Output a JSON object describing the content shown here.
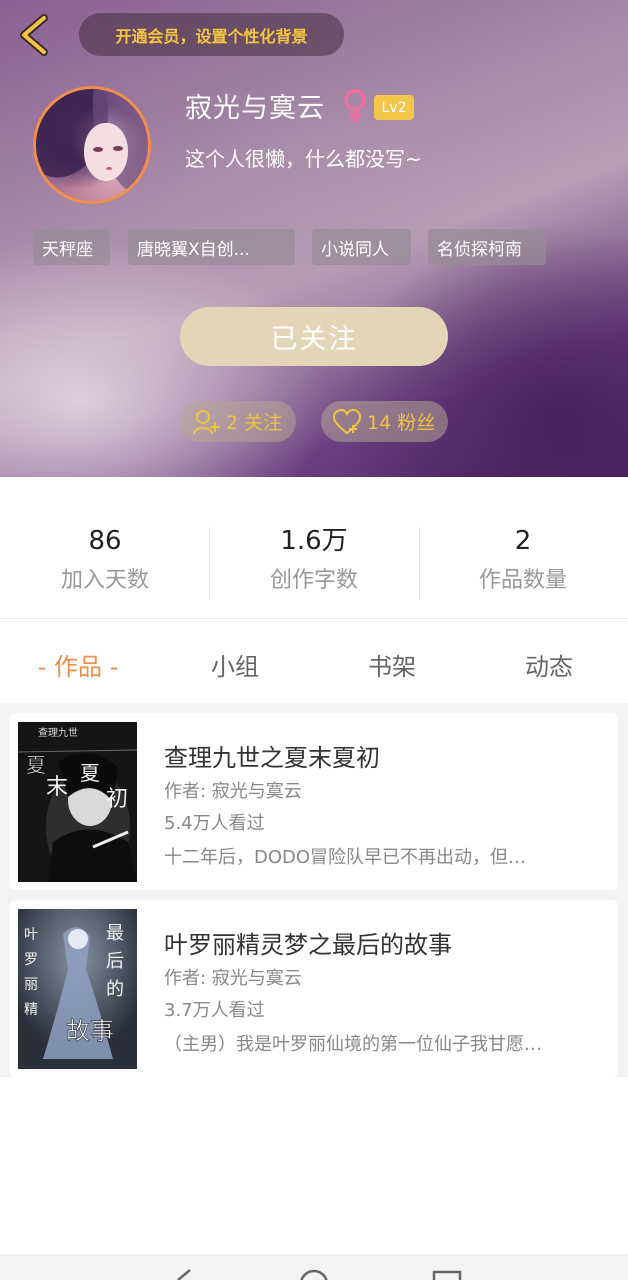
{
  "header": {
    "vip_banner": "开通会员，设置个性化背景",
    "username": "寂光与寞云",
    "level": "Lv2",
    "bio": "这个人很懒，什么都没写~",
    "tags": [
      "天秤座",
      "唐晓翼X自创...",
      "小说同人",
      "名侦探柯南"
    ],
    "follow_button": "已关注",
    "following": "2 关注",
    "fans": "14 粉丝",
    "accent_color": "#f08e4c",
    "badge_color": "#f3c64a"
  },
  "stats": [
    {
      "value": "86",
      "label": "加入天数"
    },
    {
      "value": "1.6万",
      "label": "创作字数"
    },
    {
      "value": "2",
      "label": "作品数量"
    }
  ],
  "tabs": [
    "- 作品 -",
    "小组",
    "书架",
    "动态"
  ],
  "works": [
    {
      "title": "查理九世之夏末夏初",
      "author": "作者: 寂光与寞云",
      "views": "5.4万人看过",
      "desc": "十二年后，DODO冒险队早已不再出动，但…"
    },
    {
      "title": "叶罗丽精灵梦之最后的故事",
      "author": "作者: 寂光与寞云",
      "views": "3.7万人看过",
      "desc": "（主男）我是叶罗丽仙境的第一位仙子我甘愿…"
    }
  ]
}
